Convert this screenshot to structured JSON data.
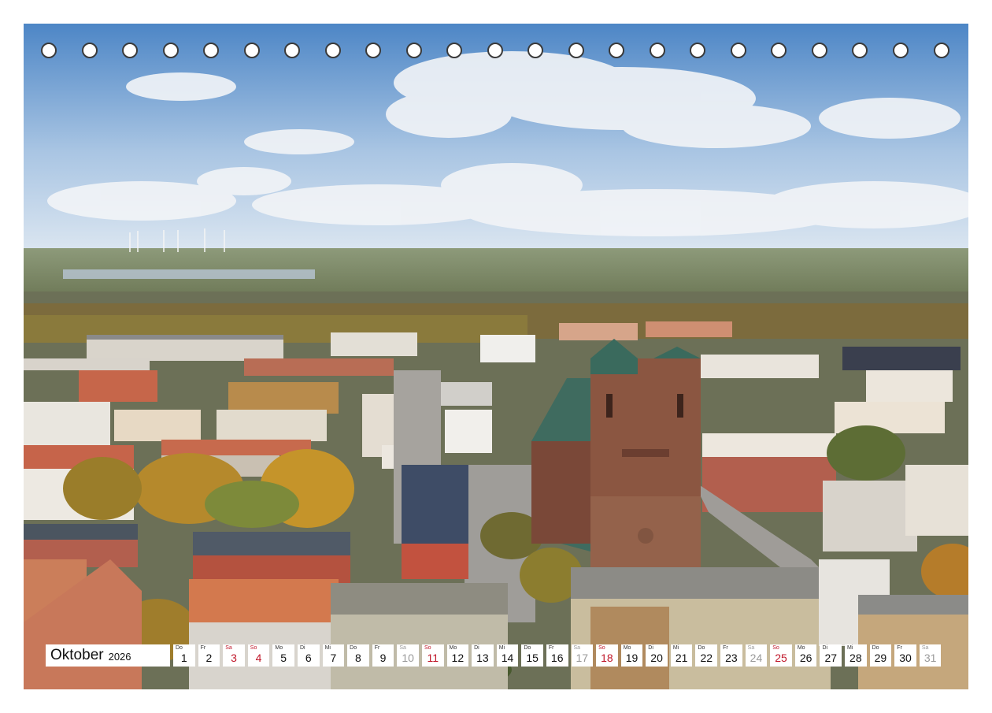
{
  "calendar": {
    "month": "Oktober",
    "year": "2026",
    "days": [
      {
        "wd": "Do",
        "d": "1",
        "type": "weekday"
      },
      {
        "wd": "Fr",
        "d": "2",
        "type": "weekday"
      },
      {
        "wd": "Sa",
        "d": "3",
        "type": "holiday"
      },
      {
        "wd": "So",
        "d": "4",
        "type": "sun"
      },
      {
        "wd": "Mo",
        "d": "5",
        "type": "weekday"
      },
      {
        "wd": "Di",
        "d": "6",
        "type": "weekday"
      },
      {
        "wd": "Mi",
        "d": "7",
        "type": "weekday"
      },
      {
        "wd": "Do",
        "d": "8",
        "type": "weekday"
      },
      {
        "wd": "Fr",
        "d": "9",
        "type": "weekday"
      },
      {
        "wd": "Sa",
        "d": "10",
        "type": "sat"
      },
      {
        "wd": "So",
        "d": "11",
        "type": "sun"
      },
      {
        "wd": "Mo",
        "d": "12",
        "type": "weekday"
      },
      {
        "wd": "Di",
        "d": "13",
        "type": "weekday"
      },
      {
        "wd": "Mi",
        "d": "14",
        "type": "weekday"
      },
      {
        "wd": "Do",
        "d": "15",
        "type": "weekday"
      },
      {
        "wd": "Fr",
        "d": "16",
        "type": "weekday"
      },
      {
        "wd": "Sa",
        "d": "17",
        "type": "sat"
      },
      {
        "wd": "So",
        "d": "18",
        "type": "sun"
      },
      {
        "wd": "Mo",
        "d": "19",
        "type": "weekday"
      },
      {
        "wd": "Di",
        "d": "20",
        "type": "weekday"
      },
      {
        "wd": "Mi",
        "d": "21",
        "type": "weekday"
      },
      {
        "wd": "Do",
        "d": "22",
        "type": "weekday"
      },
      {
        "wd": "Fr",
        "d": "23",
        "type": "weekday"
      },
      {
        "wd": "Sa",
        "d": "24",
        "type": "sat"
      },
      {
        "wd": "So",
        "d": "25",
        "type": "sun"
      },
      {
        "wd": "Mo",
        "d": "26",
        "type": "weekday"
      },
      {
        "wd": "Di",
        "d": "27",
        "type": "weekday"
      },
      {
        "wd": "Mi",
        "d": "28",
        "type": "weekday"
      },
      {
        "wd": "Do",
        "d": "29",
        "type": "weekday"
      },
      {
        "wd": "Fr",
        "d": "30",
        "type": "weekday"
      },
      {
        "wd": "Sa",
        "d": "31",
        "type": "sat"
      }
    ]
  },
  "colors": {
    "sunday": "#c0172a",
    "saturday": "#9a9a9a",
    "text": "#111111"
  }
}
